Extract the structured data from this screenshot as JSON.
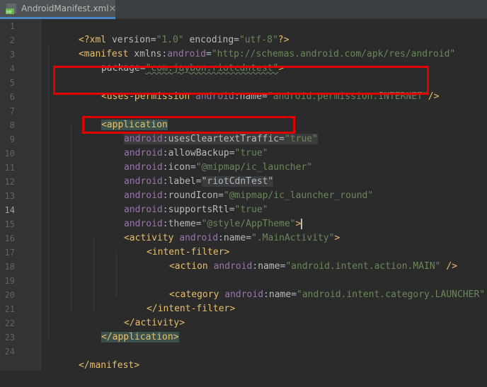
{
  "tab": {
    "title": "AndroidManifest.xml",
    "icon": "xml-manifest-file-icon",
    "icon_badge": "MF",
    "close_glyph": "×"
  },
  "editor": {
    "current_line": 14,
    "line_numbers": [
      "1",
      "2",
      "3",
      "4",
      "5",
      "6",
      "7",
      "8",
      "9",
      "10",
      "11",
      "12",
      "13",
      "14",
      "15",
      "16",
      "17",
      "18",
      "19",
      "20",
      "21",
      "22",
      "23",
      "24"
    ],
    "lines": {
      "l1": {
        "t1": "<?xml ",
        "a1": "version",
        "e1": "=",
        "v1": "\"1.0\"",
        "s1": " ",
        "a2": "encoding",
        "e2": "=",
        "v2": "\"utf-8\"",
        "t2": "?>"
      },
      "l2": {
        "t1": "<manifest ",
        "a1": "xmlns",
        "c1": ":",
        "n1": "android",
        "e1": "=",
        "v1": "\"http://schemas.android.com/apk/res/android\""
      },
      "l3": {
        "a1": "package",
        "e1": "=",
        "v1": "\"com.jaybon.riotcdntest\"",
        "t1": ">"
      },
      "l5": {
        "t1": "<uses-permission ",
        "n1": "android",
        "c1": ":",
        "a1": "name",
        "e1": "=",
        "v1": "\"android.permission.INTERNET\"",
        "t2": "/>"
      },
      "l7": {
        "t1": "<application"
      },
      "l8": {
        "n1": "android",
        "c1": ":",
        "a1": "usesCleartextTraffic",
        "e1": "=",
        "v1": "\"true\""
      },
      "l9": {
        "n1": "android",
        "c1": ":",
        "a1": "allowBackup",
        "e1": "=",
        "v1": "\"true\""
      },
      "l10": {
        "n1": "android",
        "c1": ":",
        "a1": "icon",
        "e1": "=",
        "v1": "\"@mipmap/ic_launcher\""
      },
      "l11": {
        "n1": "android",
        "c1": ":",
        "a1": "label",
        "e1": "=",
        "v1": "\"riotCdnTest\""
      },
      "l12": {
        "n1": "android",
        "c1": ":",
        "a1": "roundIcon",
        "e1": "=",
        "v1": "\"@mipmap/ic_launcher_round\""
      },
      "l13": {
        "n1": "android",
        "c1": ":",
        "a1": "supportsRtl",
        "e1": "=",
        "v1": "\"true\""
      },
      "l14": {
        "n1": "android",
        "c1": ":",
        "a1": "theme",
        "e1": "=",
        "v1": "\"@style/AppTheme\"",
        "t1": ">"
      },
      "l15": {
        "t1": "<activity ",
        "n1": "android",
        "c1": ":",
        "a1": "name",
        "e1": "=",
        "v1": "\".MainActivity\"",
        "t2": ">"
      },
      "l16": {
        "t1": "<intent-filter>"
      },
      "l17": {
        "t1": "<action ",
        "n1": "android",
        "c1": ":",
        "a1": "name",
        "e1": "=",
        "v1": "\"android.intent.action.MAIN\"",
        "t2": " />"
      },
      "l19": {
        "t1": "<category ",
        "n1": "android",
        "c1": ":",
        "a1": "name",
        "e1": "=",
        "v1": "\"android.intent.category.LAUNCHER\"",
        "t2": " />"
      },
      "l20": {
        "t1": "</intent-filter>"
      },
      "l21": {
        "t1": "</activity>"
      },
      "l22": {
        "t1": "</application>"
      },
      "l24": {
        "t1": "</manifest>"
      }
    }
  },
  "colors": {
    "background": "#2b2b2b",
    "gutter": "#313335",
    "tag": "#e8bf6a",
    "namespace": "#9876aa",
    "attribute": "#bababa",
    "value": "#6a8759",
    "annotation_box": "#e00000"
  }
}
